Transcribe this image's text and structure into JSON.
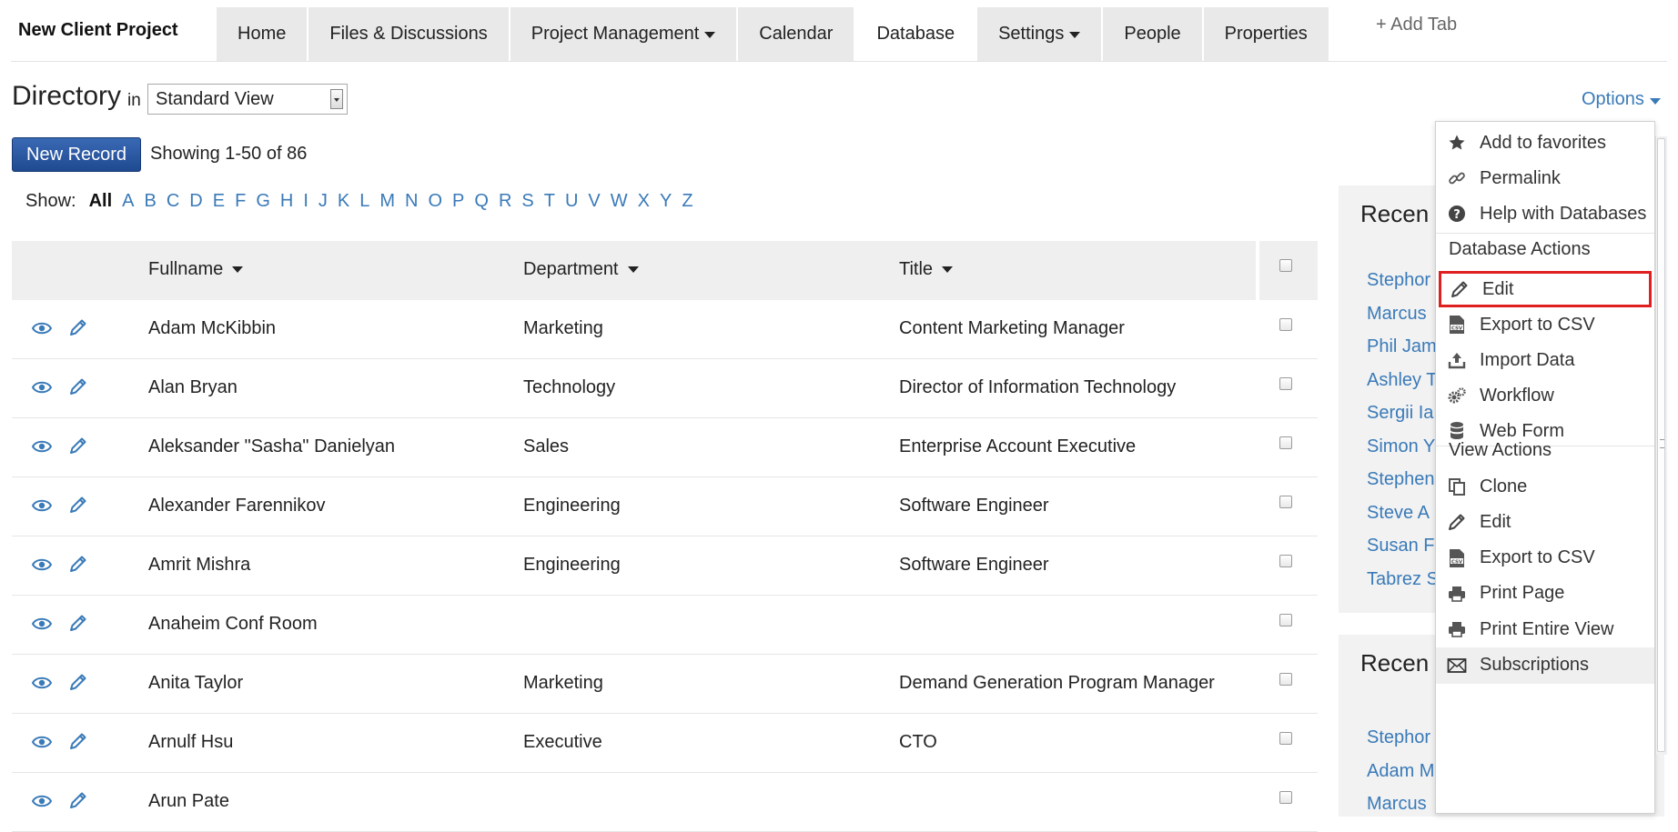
{
  "project": {
    "title": "New Client Project"
  },
  "tabs": [
    {
      "label": "Home",
      "active": false,
      "dropdown": false
    },
    {
      "label": "Files & Discussions",
      "active": false,
      "dropdown": false
    },
    {
      "label": "Project Management",
      "active": false,
      "dropdown": true
    },
    {
      "label": "Calendar",
      "active": false,
      "dropdown": false
    },
    {
      "label": "Database",
      "active": true,
      "dropdown": false
    },
    {
      "label": "Settings",
      "active": false,
      "dropdown": true
    },
    {
      "label": "People",
      "active": false,
      "dropdown": false
    },
    {
      "label": "Properties",
      "active": false,
      "dropdown": false
    }
  ],
  "add_tab": "+ Add Tab",
  "directory": {
    "title": "Directory",
    "in_label": "in",
    "view_select": "Standard View",
    "options_label": "Options",
    "new_record_label": "New Record",
    "showing": "Showing 1-50 of 86"
  },
  "alphabet": {
    "show_label": "Show:",
    "letters": [
      "All",
      "A",
      "B",
      "C",
      "D",
      "E",
      "F",
      "G",
      "H",
      "I",
      "J",
      "K",
      "L",
      "M",
      "N",
      "O",
      "P",
      "Q",
      "R",
      "S",
      "T",
      "U",
      "V",
      "W",
      "X",
      "Y",
      "Z"
    ]
  },
  "table": {
    "headers": {
      "fullname": "Fullname",
      "department": "Department",
      "title": "Title"
    },
    "rows": [
      {
        "name": "Adam McKibbin",
        "dept": "Marketing",
        "title": "Content Marketing Manager"
      },
      {
        "name": "Alan Bryan",
        "dept": "Technology",
        "title": "Director of Information Technology"
      },
      {
        "name": "Aleksander \"Sasha\" Danielyan",
        "dept": "Sales",
        "title": "Enterprise Account Executive"
      },
      {
        "name": "Alexander Farennikov",
        "dept": "Engineering",
        "title": "Software Engineer"
      },
      {
        "name": "Amrit Mishra",
        "dept": "Engineering",
        "title": "Software Engineer"
      },
      {
        "name": "Anaheim Conf Room",
        "dept": "",
        "title": ""
      },
      {
        "name": "Anita Taylor",
        "dept": "Marketing",
        "title": "Demand Generation Program Manager"
      },
      {
        "name": "Arnulf Hsu",
        "dept": "Executive",
        "title": "CTO"
      },
      {
        "name": "Arun Pate",
        "dept": "",
        "title": ""
      }
    ]
  },
  "side": {
    "panel1_title": "Recen",
    "panel1_links": [
      "Stephor",
      "Marcus",
      "Phil Jam",
      "Ashley T",
      "Sergii Ia",
      "Simon Y",
      "Stephen",
      "Steve A",
      "Susan F",
      "Tabrez S"
    ],
    "panel2_title": "Recen",
    "panel2_links": [
      "Stephor",
      "Adam M",
      "Marcus"
    ]
  },
  "dropdown": {
    "top_items": [
      {
        "label": "Add to favorites",
        "icon": "star-icon"
      },
      {
        "label": "Permalink",
        "icon": "link-icon"
      },
      {
        "label": "Help with Databases",
        "icon": "help-icon"
      }
    ],
    "db_actions_heading": "Database Actions",
    "db_actions": [
      {
        "label": "Edit",
        "icon": "pencil-icon"
      },
      {
        "label": "Export to CSV",
        "icon": "csv-file-icon"
      },
      {
        "label": "Import Data",
        "icon": "upload-icon"
      },
      {
        "label": "Workflow",
        "icon": "gears-icon"
      },
      {
        "label": "Web Form",
        "icon": "database-icon"
      }
    ],
    "view_actions_heading": "View Actions",
    "view_actions": [
      {
        "label": "Clone",
        "icon": "copy-icon"
      },
      {
        "label": "Edit",
        "icon": "pencil-icon"
      },
      {
        "label": "Export to CSV",
        "icon": "csv-file-icon"
      },
      {
        "label": "Print Page",
        "icon": "printer-icon"
      },
      {
        "label": "Print Entire View",
        "icon": "printer-icon"
      },
      {
        "label": "Subscriptions",
        "icon": "envelope-icon"
      }
    ]
  },
  "colors": {
    "link": "#3a7ab8",
    "button": "#2a5aa3",
    "highlight": "#e02020",
    "header_bg": "#efefef"
  }
}
